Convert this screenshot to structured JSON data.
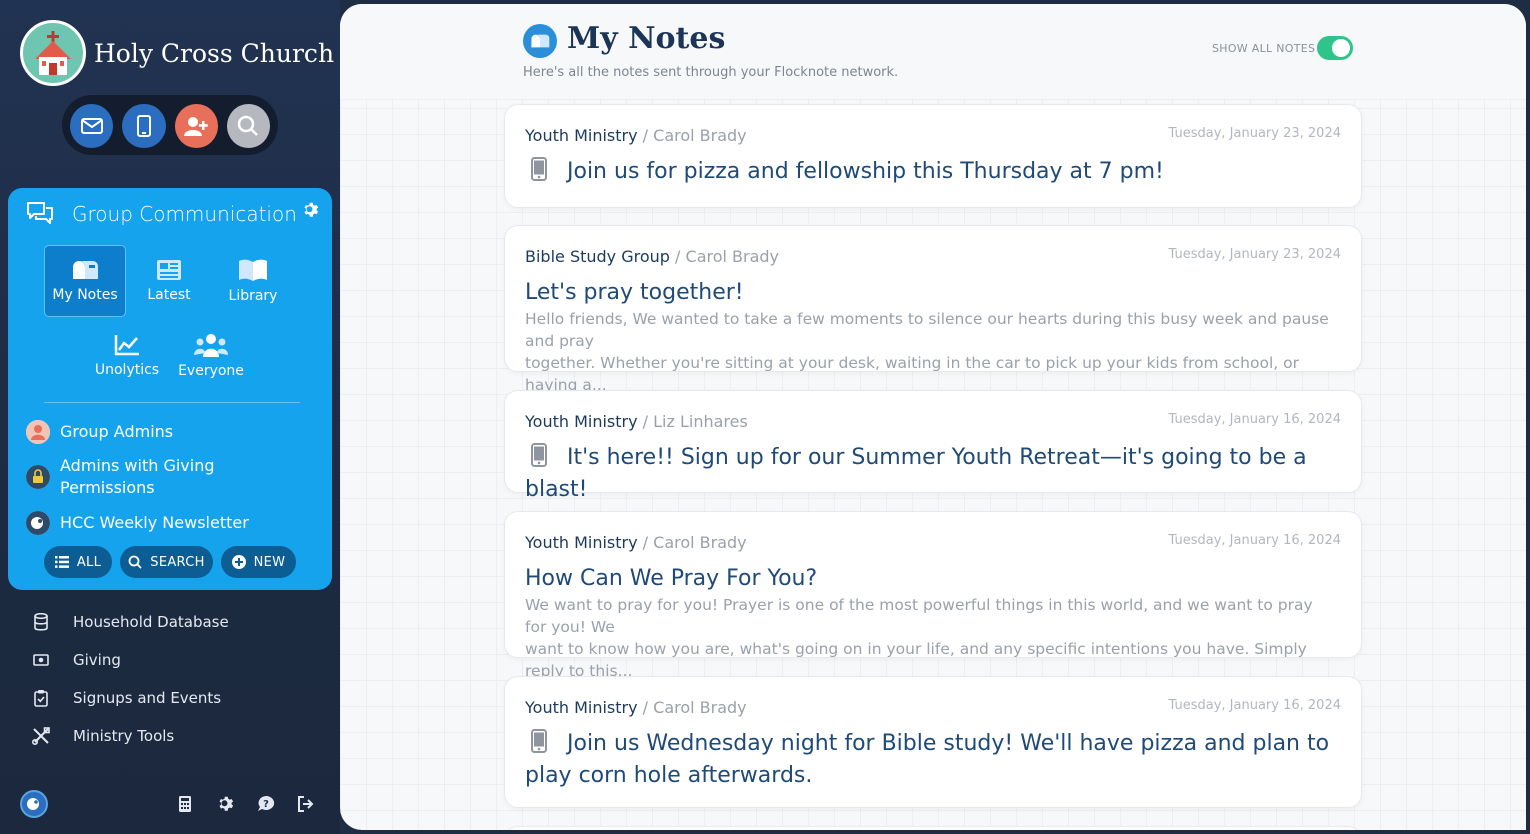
{
  "brand": {
    "name": "Holy Cross Church"
  },
  "quick_actions": [
    {
      "icon": "envelope-icon",
      "color": "#2b6dbf"
    },
    {
      "icon": "mobile-phone-icon",
      "color": "#2b6dbf"
    },
    {
      "icon": "add-person-icon",
      "color": "#e8705a"
    },
    {
      "icon": "search-icon",
      "color": "#b5b9bf"
    }
  ],
  "group_panel": {
    "title": "Group Communication",
    "tiles": [
      {
        "label": "My Notes",
        "icon": "mailbox-icon",
        "active": true
      },
      {
        "label": "Latest",
        "icon": "newspaper-icon",
        "active": false
      },
      {
        "label": "Library",
        "icon": "book-icon",
        "active": false
      },
      {
        "label": "Unolytics",
        "icon": "chart-icon",
        "active": false
      },
      {
        "label": "Everyone",
        "icon": "people-icon",
        "active": false
      }
    ],
    "groups": [
      {
        "label": "Group Admins"
      },
      {
        "label": "Admins with Giving\nPermissions"
      },
      {
        "label": "HCC Weekly Newsletter"
      }
    ],
    "buttons": {
      "all": "ALL",
      "search": "SEARCH",
      "new": "NEW"
    }
  },
  "nav": [
    {
      "label": "Household Database",
      "icon": "database-icon"
    },
    {
      "label": "Giving",
      "icon": "money-icon"
    },
    {
      "label": "Signups and Events",
      "icon": "clipboard-icon"
    },
    {
      "label": "Ministry Tools",
      "icon": "tools-icon"
    }
  ],
  "main": {
    "title": "My Notes",
    "subtitle": "Here's all the notes sent through your Flocknote network.",
    "toggle_label": "SHOW ALL NOTES",
    "toggle_on": true
  },
  "notes": [
    {
      "group": "Youth Ministry",
      "author": "Carol Brady",
      "date": "Tuesday, January 23, 2024",
      "type": "text",
      "title": "Join us for pizza and fellowship this Thursday at 7 pm!",
      "preview": ""
    },
    {
      "group": "Bible Study Group",
      "author": "Carol Brady",
      "date": "Tuesday, January 23, 2024",
      "type": "email",
      "title": "Let's pray together!",
      "preview": "Hello friends, We wanted to take a few moments to silence our hearts during this busy week and pause and pray\ntogether. Whether you're sitting at your desk, waiting in the car to pick up your kids from school, or having a..."
    },
    {
      "group": "Youth Ministry",
      "author": "Liz Linhares",
      "date": "Tuesday, January 16, 2024",
      "type": "text",
      "title": "It's here!! Sign up for our Summer Youth Retreat—it's going to be a blast!",
      "preview": ""
    },
    {
      "group": "Youth Ministry",
      "author": "Carol Brady",
      "date": "Tuesday, January 16, 2024",
      "type": "email",
      "title": "How Can We Pray For You?",
      "preview": "We want to pray for you! Prayer is one of the most powerful things in this world, and we want to pray for you! We\nwant to know how you are, what's going on in your life, and any specific intentions you have. Simply reply to this..."
    },
    {
      "group": "Youth Ministry",
      "author": "Carol Brady",
      "date": "Tuesday, January 16, 2024",
      "type": "text",
      "title": "Join us Wednesday night for Bible study! We'll have pizza and plan to play corn hole afterwards.",
      "preview": ""
    }
  ]
}
